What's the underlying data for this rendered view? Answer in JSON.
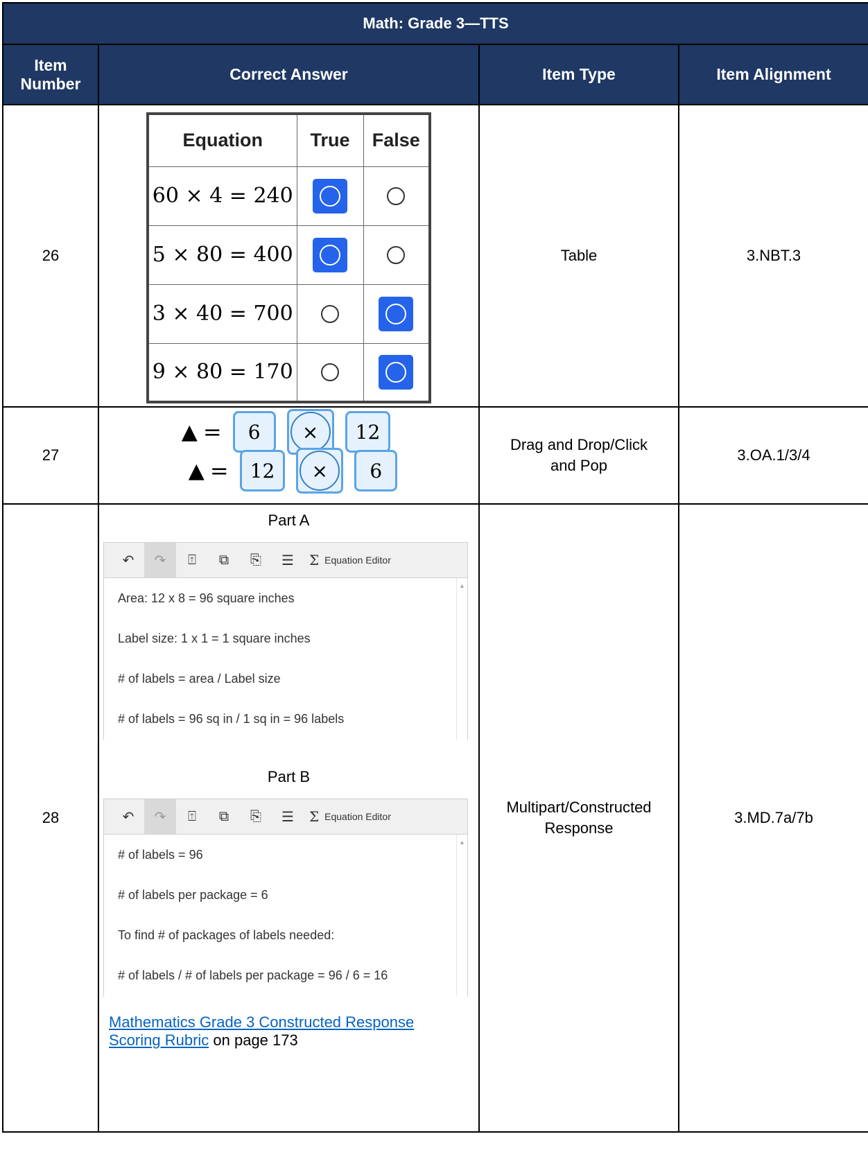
{
  "title": "Math: Grade 3—TTS",
  "headers": {
    "item_number": "Item Number",
    "correct_answer": "Correct Answer",
    "item_type": "Item Type",
    "item_alignment": "Item Alignment"
  },
  "items": [
    {
      "number": "26",
      "type": "Table",
      "alignment": "3.NBT.3",
      "table": {
        "headers": [
          "Equation",
          "True",
          "False"
        ],
        "rows": [
          {
            "equation": "60 × 4 = 240",
            "answer": "True"
          },
          {
            "equation": "5 × 80 = 400",
            "answer": "True"
          },
          {
            "equation": "3 × 40 = 700",
            "answer": "False"
          },
          {
            "equation": "9 × 80 = 170",
            "answer": "False"
          }
        ]
      }
    },
    {
      "number": "27",
      "type": "Drag and Drop/Click and Pop",
      "alignment": "3.OA.1/3/4",
      "lines": [
        {
          "symbol": "▲",
          "equals": "=",
          "a": "6",
          "op": "×",
          "b": "12"
        },
        {
          "symbol": "▲",
          "equals": "=",
          "a": "12",
          "op": "×",
          "b": "6"
        }
      ]
    },
    {
      "number": "28",
      "type": "Multipart/Constructed Response",
      "alignment": "3.MD.7a/7b",
      "editor_label": "Equation Editor",
      "part_a": {
        "label": "Part A",
        "lines": [
          "Area:  12 x 8 = 96 square inches",
          "Label size:  1 x 1 = 1 square inches",
          "# of labels = area /  Label size",
          "# of labels = 96 sq in / 1 sq in = 96 labels"
        ]
      },
      "part_b": {
        "label": "Part B",
        "lines": [
          "# of labels = 96",
          "# of labels per package = 6",
          "To find # of packages of labels needed:",
          "# of labels / # of labels per package = 96 / 6 = 16"
        ]
      },
      "rubric_link_line1": "Mathematics Grade 3 Constructed Response ",
      "rubric_link_line2": "Scoring Rubric",
      "rubric_suffix": " on page 173"
    }
  ]
}
